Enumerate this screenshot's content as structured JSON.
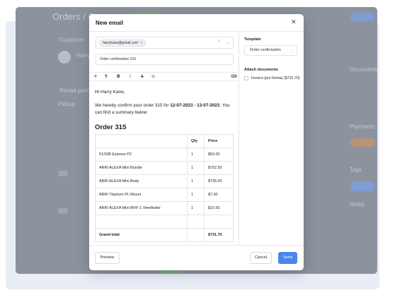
{
  "background_app": {
    "title": "Orders",
    "crumb_prefix": "Or",
    "customer_label": "Customer",
    "customer_initials": "Harry",
    "rental_label": "Rental period",
    "pickup_label": "Pickup",
    "right_label": "Documents",
    "payments_label": "Payments",
    "tags_label": "Tags",
    "notes_label": "Notes"
  },
  "modal": {
    "title": "New email",
    "to": {
      "chip": "harrykane@gmail.com",
      "chip_remove": "×",
      "clear": "×",
      "caret": "⌄"
    },
    "subject": "Order confirmation 315",
    "toolbar": {
      "plus": "+",
      "paragraph": "¶",
      "bold": "B",
      "italic": "I",
      "strike": "S",
      "link": "⊝",
      "more": "⌨"
    },
    "body": {
      "greeting": "Hi Harry Kane,",
      "line_before": "We hereby confirm your order 315 for ",
      "date_range": "12-07-2023 - 13-07-2023",
      "line_after": ". You can find a summary below:",
      "order_heading": "Order 315"
    },
    "table": {
      "headers": [
        "",
        "Qty",
        "Price"
      ],
      "rows": [
        [
          "512GB Express P2",
          "1",
          "$50.00"
        ],
        [
          "ARRI ALEXA Mini Bundle",
          "1",
          "$752.50"
        ],
        [
          "ARRI ALEXA Mini Body",
          "1",
          "$735.00"
        ],
        [
          "ARRI Titanium PL Mount",
          "1",
          "$7.00"
        ],
        [
          "ARRI ALEXA Mini MVF-1 Viewfinder",
          "1",
          "$10.50"
        ],
        [
          "",
          "",
          ""
        ]
      ],
      "total": [
        "Grand total",
        "",
        "$731.70"
      ]
    },
    "sidebar": {
      "template_label": "Template",
      "template_value": "Order confirmation",
      "template_caret": "⌄",
      "attach_label": "Attach documents",
      "attachment": "Invoice (pro forma) ($731.70)"
    },
    "footer": {
      "preview": "Preview",
      "cancel": "Cancel",
      "send": "Send"
    },
    "close": "✕"
  },
  "colors": {
    "accent": "#4b86e8",
    "overlay": "#8d929f"
  }
}
